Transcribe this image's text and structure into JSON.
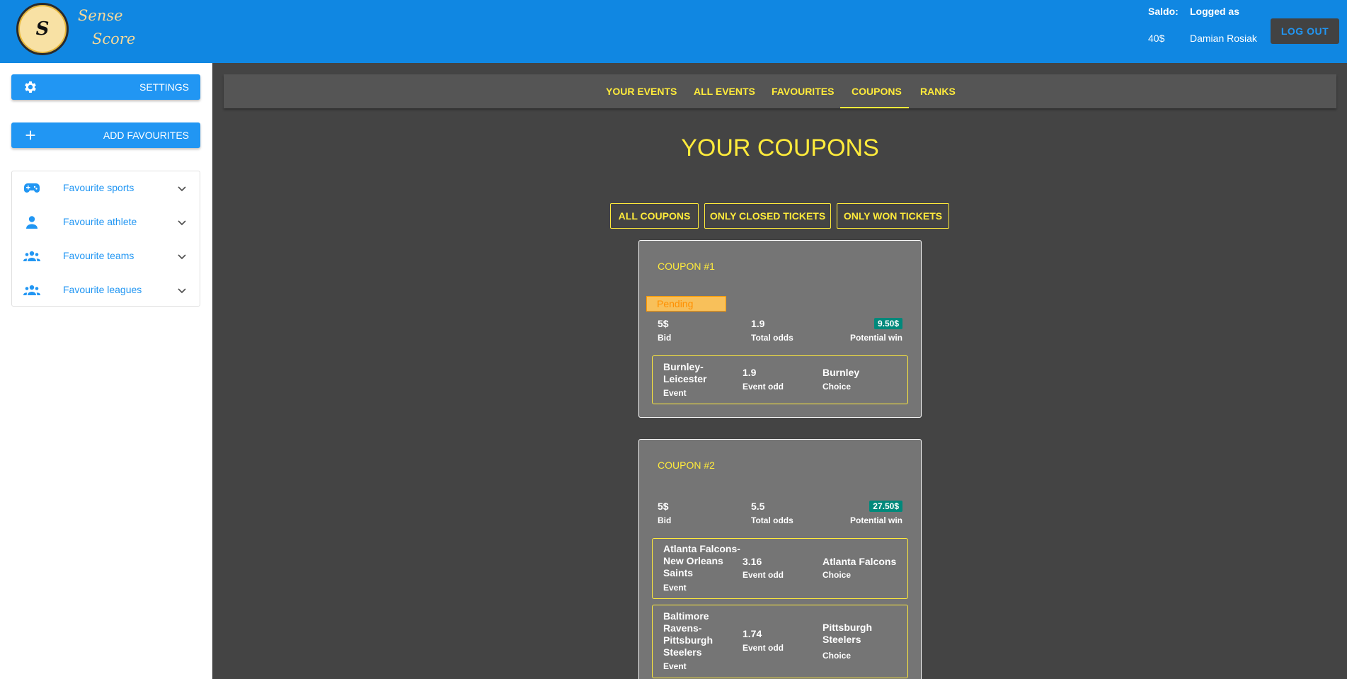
{
  "header": {
    "logo_letter": "S",
    "logo_word1": "Sense",
    "logo_word2": "Score",
    "saldo_label": "Saldo:",
    "saldo_value": "40$",
    "logged_label": "Logged as",
    "logged_value": "Damian Rosiak",
    "logout_label": "LOG OUT"
  },
  "sidebar": {
    "settings_label": "SETTINGS",
    "add_favourites_label": "ADD FAVOURITES",
    "favourites": [
      {
        "label": "Favourite sports",
        "icon": "gamepad-icon"
      },
      {
        "label": "Favourite athlete",
        "icon": "person-icon"
      },
      {
        "label": "Favourite teams",
        "icon": "group-icon"
      },
      {
        "label": "Favourite leagues",
        "icon": "group-icon"
      }
    ]
  },
  "tabs": [
    {
      "label": "YOUR EVENTS"
    },
    {
      "label": "ALL EVENTS"
    },
    {
      "label": "FAVOURITES"
    },
    {
      "label": "COUPONS",
      "active": true
    },
    {
      "label": "RANKS"
    }
  ],
  "page_title": "YOUR COUPONS",
  "filters": [
    {
      "label": "ALL COUPONS"
    },
    {
      "label": "ONLY CLOSED TICKETS"
    },
    {
      "label": "ONLY WON TICKETS"
    }
  ],
  "coupons": [
    {
      "title": "COUPON #1",
      "status": "Pending",
      "bid": "5$",
      "bid_label": "Bid",
      "total_odds": "1.9",
      "total_odds_label": "Total odds",
      "potential_win": "9.50$",
      "potential_win_label": "Potential win",
      "bets": [
        {
          "event": "Burnley-Leicester",
          "event_label": "Event",
          "odd": "1.9",
          "odd_label": "Event odd",
          "choice": "Burnley",
          "choice_label": "Choice"
        }
      ]
    },
    {
      "title": "COUPON #2",
      "bid": "5$",
      "bid_label": "Bid",
      "total_odds": "5.5",
      "total_odds_label": "Total odds",
      "potential_win": "27.50$",
      "potential_win_label": "Potential win",
      "bets": [
        {
          "event": "Atlanta Falcons-New Orleans Saints",
          "event_label": "Event",
          "odd": "3.16",
          "odd_label": "Event odd",
          "choice": "Atlanta Falcons",
          "choice_label": "Choice"
        },
        {
          "event": "Baltimore Ravens-Pittsburgh Steelers",
          "event_label": "Event",
          "odd": "1.74",
          "odd_label": "Event odd",
          "choice": "Pittsburgh Steelers",
          "choice_label": "Choice"
        }
      ]
    }
  ],
  "colors": {
    "header_bg": "#1087e2",
    "accent_yellow": "#ffeb3b",
    "primary_blue": "#2196f3",
    "main_bg": "#444444",
    "win_badge": "#00897b"
  }
}
